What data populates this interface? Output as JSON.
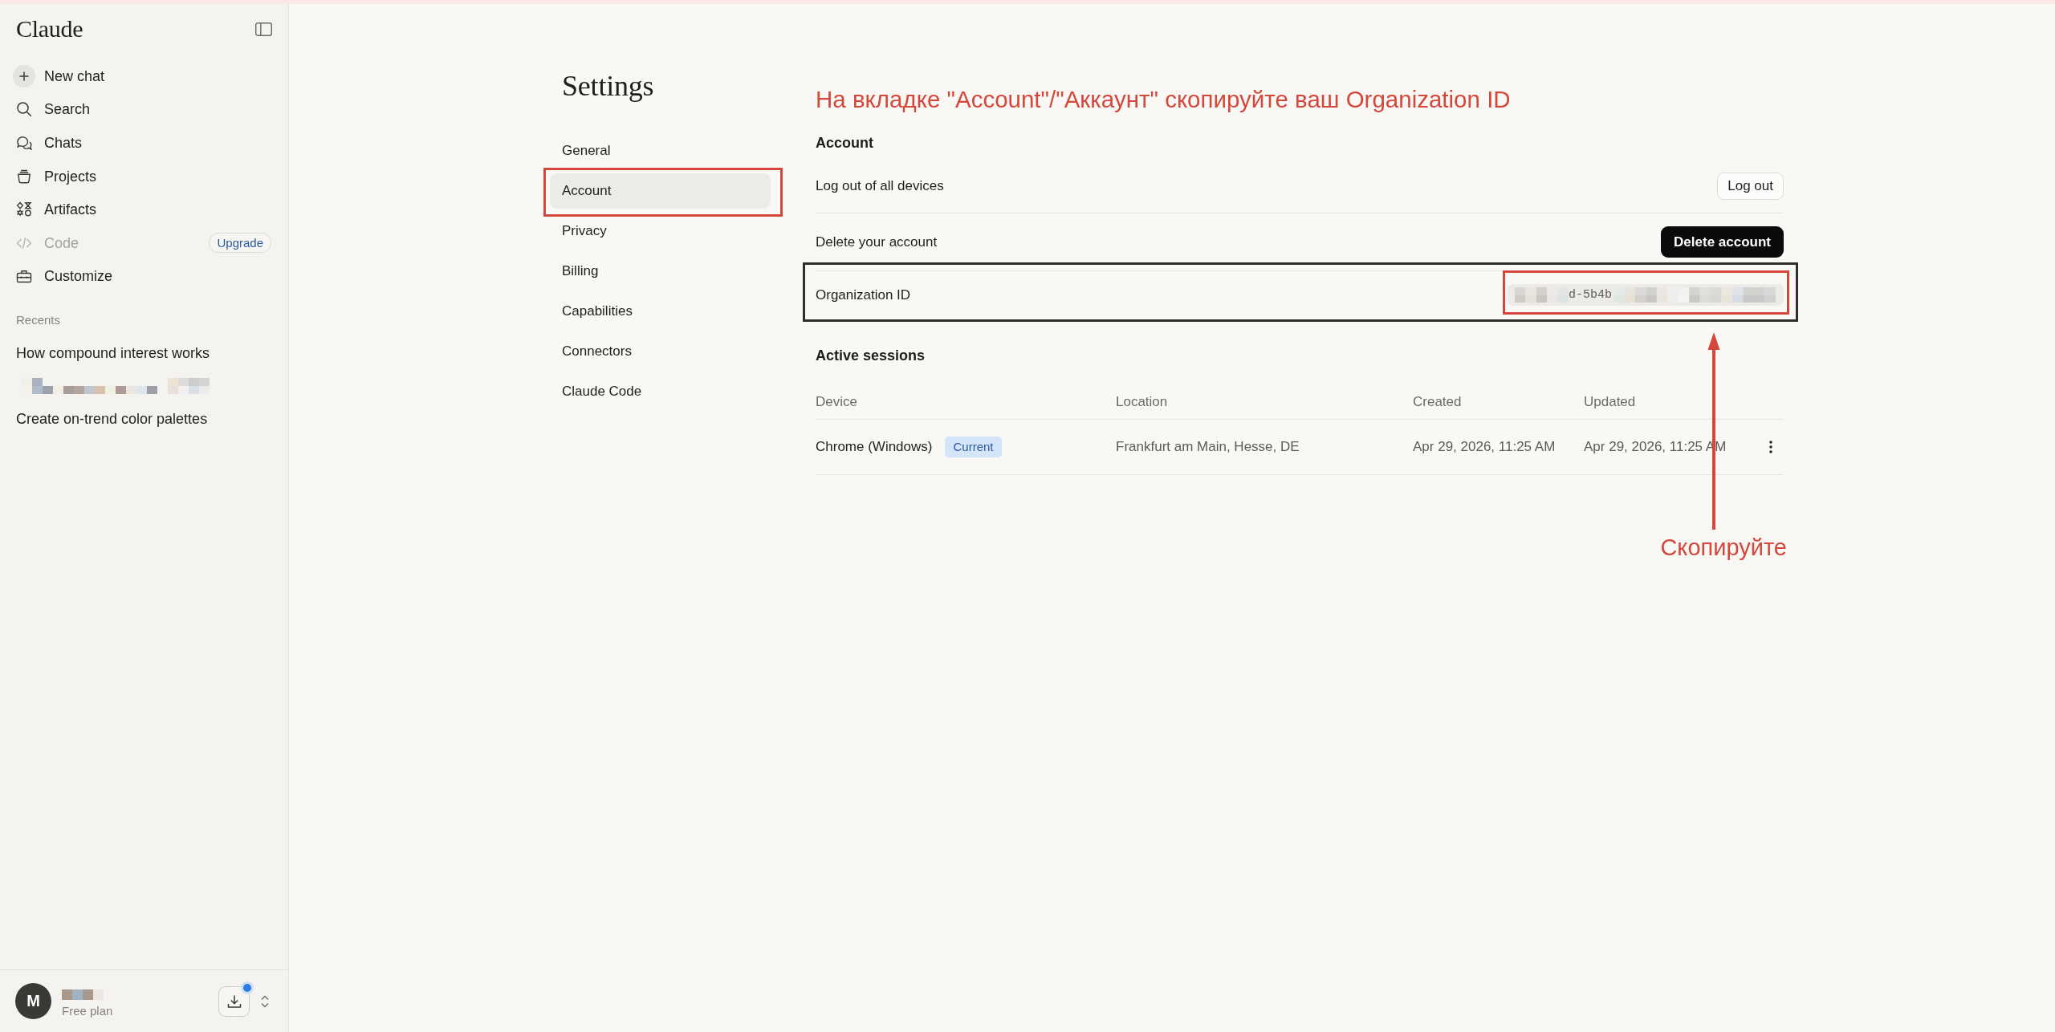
{
  "sidebar": {
    "logo": "Claude",
    "items": [
      {
        "label": "New chat",
        "disabled": false
      },
      {
        "label": "Search",
        "disabled": false
      },
      {
        "label": "Chats",
        "disabled": false
      },
      {
        "label": "Projects",
        "disabled": false
      },
      {
        "label": "Artifacts",
        "disabled": false
      },
      {
        "label": "Code",
        "disabled": true,
        "badge": "Upgrade"
      },
      {
        "label": "Customize",
        "disabled": false
      }
    ],
    "recents_label": "Recents",
    "recents": [
      {
        "title": "How compound interest works",
        "redacted": false
      },
      {
        "redacted": true
      },
      {
        "title": "Create on-trend color palettes",
        "redacted": false
      }
    ],
    "account": {
      "initial": "M",
      "name_redacted": true,
      "plan": "Free plan",
      "notification": true
    }
  },
  "settings": {
    "title": "Settings",
    "nav": [
      {
        "label": "General",
        "selected": false,
        "annotated": false
      },
      {
        "label": "Account",
        "selected": true,
        "annotated": true
      },
      {
        "label": "Privacy",
        "selected": false,
        "annotated": false
      },
      {
        "label": "Billing",
        "selected": false,
        "annotated": false
      },
      {
        "label": "Capabilities",
        "selected": false,
        "annotated": false
      },
      {
        "label": "Connectors",
        "selected": false,
        "annotated": false
      },
      {
        "label": "Claude Code",
        "selected": false,
        "annotated": false
      }
    ]
  },
  "annotation": {
    "title": "На вкладке \"Account\"/\"Аккаунт\" скопируйте ваш Organization ID",
    "arrow_label": "Скопируйте"
  },
  "account": {
    "title": "Account",
    "rows": [
      {
        "kind": "action",
        "label": "Log out of all devices",
        "action": "Log out"
      },
      {
        "kind": "danger",
        "label": "Delete your account",
        "action": "Delete account"
      },
      {
        "kind": "id",
        "label": "Organization ID",
        "value_visible": "d-5b4b",
        "framed": true,
        "value_framed": true
      }
    ]
  },
  "sessions": {
    "title": "Active sessions",
    "columns": [
      "Device",
      "Location",
      "Created",
      "Updated"
    ],
    "rows": [
      {
        "device": "Chrome (Windows)",
        "badge": "Current",
        "location": "Frankfurt am Main, Hesse, DE",
        "created": "Apr 29, 2026, 11:25 AM",
        "updated": "Apr 29, 2026, 11:25 AM"
      }
    ]
  }
}
